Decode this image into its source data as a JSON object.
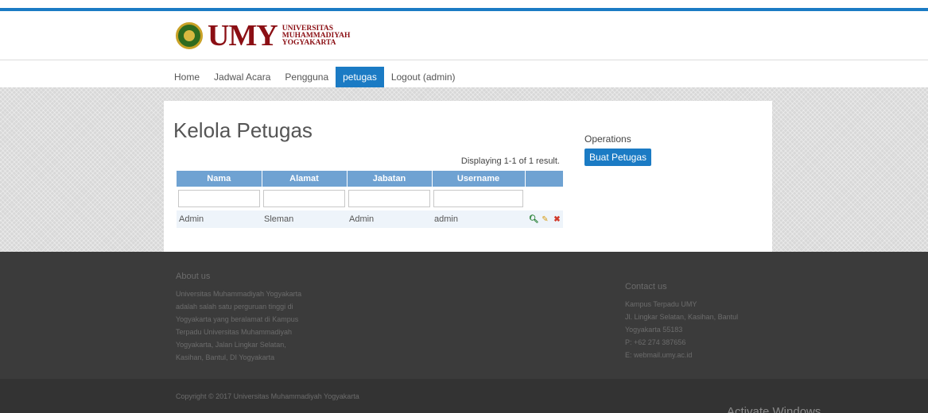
{
  "header": {
    "logo_text": "UMY",
    "logo_line1": "UNIVERSITAS",
    "logo_line2": "MUHAMMADIYAH",
    "logo_line3": "YOGYAKARTA"
  },
  "nav": {
    "items": [
      {
        "label": "Home"
      },
      {
        "label": "Jadwal Acara"
      },
      {
        "label": "Pengguna"
      },
      {
        "label": "petugas"
      },
      {
        "label": "Logout (admin)"
      }
    ],
    "active": "petugas"
  },
  "main": {
    "title": "Kelola Petugas",
    "summary": "Displaying 1-1 of 1 result.",
    "columns": [
      "Nama",
      "Alamat",
      "Jabatan",
      "Username"
    ],
    "rows": [
      {
        "nama": "Admin",
        "alamat": "Sleman",
        "jabatan": "Admin",
        "username": "admin"
      }
    ],
    "action_icons": [
      "view-icon",
      "edit-icon",
      "delete-icon"
    ]
  },
  "operations": {
    "title": "Operations",
    "button_label": "Buat Petugas"
  },
  "footer": {
    "about_title": "About us",
    "about_lines": [
      "Universitas Muhammadiyah Yogyakarta",
      "adalah salah satu perguruan tinggi di",
      "Yogyakarta yang beralamat di Kampus",
      "Terpadu Universitas Muhammadiyah",
      "Yogyakarta, Jalan Lingkar Selatan,",
      "Kasihan, Bantul, DI Yogyakarta"
    ],
    "contact_title": "Contact us",
    "contact_lines": [
      "Kampus Terpadu UMY",
      "Jl. Lingkar Selatan, Kasihan, Bantul",
      "Yogyakarta 55183",
      "P: +62 274 387656",
      "E: webmail.umy.ac.id"
    ],
    "copyright": "Copyright © 2017 Universitas Muhammadiyah Yogyakarta"
  },
  "overlay": {
    "activate_windows": "Activate Windows"
  },
  "colors": {
    "accent": "#1b7bc4",
    "brand": "#8b0f14",
    "grid_header": "#6fa2d2",
    "footer_bg": "#3b3b3b"
  }
}
